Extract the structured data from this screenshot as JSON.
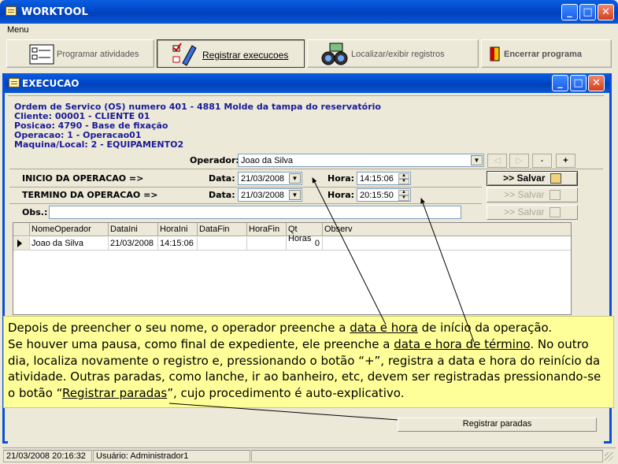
{
  "window": {
    "title": "WORKTOOL",
    "buttons": {
      "minimize": "_",
      "maximize": "□",
      "close": "✕"
    }
  },
  "menu": {
    "label": "Menu"
  },
  "toolbar": {
    "programar": "Programar atividades",
    "registrar": "Registrar execucoes",
    "localizar": "Localizar/exibir registros",
    "encerrar": "Encerrar programa"
  },
  "inner": {
    "title": "EXECUCAO"
  },
  "info": {
    "line1": "Ordem de Servico (OS) numero 401 - 4881 Molde da tampa do reservatório",
    "line2": "Cliente: 00001 - CLIENTE 01",
    "line3": "Posicao: 4790 - Base de fixação",
    "line4": "Operacao: 1 - Operacao01",
    "line5": "Maquina/Local: 2 - EQUIPAMENTO2"
  },
  "form": {
    "operador_label": "Operador:",
    "operador_value": "Joao da Silva",
    "nav": {
      "prev": "◁",
      "next": "▷",
      "minus": "-",
      "plus": "+"
    },
    "inicio_label": "INICIO DA OPERACAO =>",
    "termino_label": "TERMINO DA OPERACAO =>",
    "data_label": "Data:",
    "hora_label": "Hora:",
    "inicio_data": "21/03/2008",
    "inicio_hora": "14:15:06",
    "termino_data": "21/03/2008",
    "termino_hora": "20:15:50",
    "obs_label": "Obs.:",
    "obs_value": "",
    "salvar": ">> Salvar"
  },
  "grid": {
    "columns": [
      "NomeOperador",
      "DataIni",
      "HoraIni",
      "DataFin",
      "HoraFin",
      "Qt Horas",
      "Observ"
    ],
    "rows": [
      {
        "NomeOperador": "Joao da Silva",
        "DataIni": "21/03/2008",
        "HoraIni": "14:15:06",
        "DataFin": "",
        "HoraFin": "",
        "QtHoras": "0",
        "Observ": ""
      }
    ]
  },
  "note": {
    "t1": "Depois de preencher o seu nome, o operador preenche a ",
    "u1": "data e hora",
    "t2": " de início da operação.",
    "t3": "Se houver uma pausa, como final de expediente, ele preenche a ",
    "u2": "data e hora de término",
    "t4": ". No outro dia, localiza novamente o registro e, pressionando o botão “+”, registra a data e hora do reinício da atividade. Outras paradas, como lanche, ir ao banheiro, etc, devem ser registradas pressionando-se o botão “",
    "u3": "Registrar paradas",
    "t5": "”, cujo procedimento é auto-explicativo."
  },
  "registrar_paradas": "Registrar paradas",
  "status": {
    "datetime": "21/03/2008 20:16:32",
    "user": "Usuário: Administrador1"
  },
  "colors": {
    "titlebar": "#0047c8",
    "note_bg": "#ffff99",
    "info_text": "#1a1a99"
  }
}
